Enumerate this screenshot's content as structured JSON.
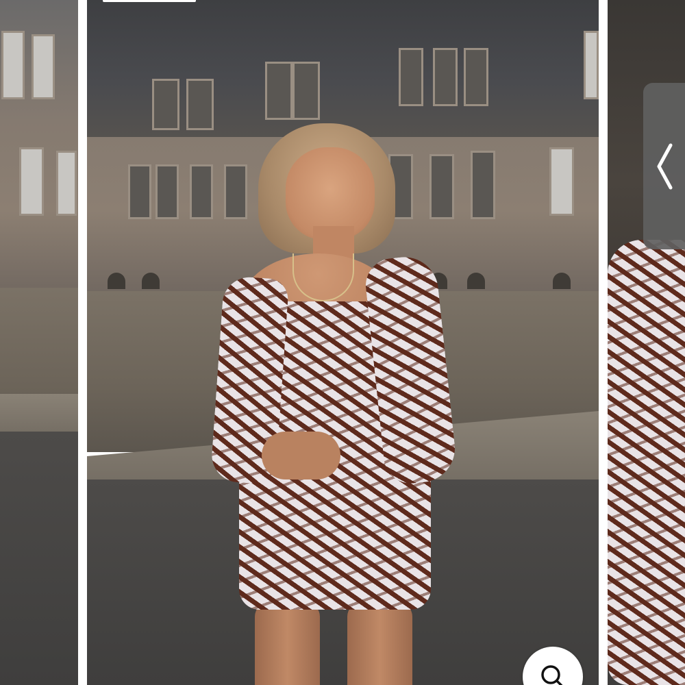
{
  "gallery": {
    "slides": [
      {
        "position": "previous",
        "description_icon": "photo"
      },
      {
        "position": "current",
        "description_icon": "photo"
      },
      {
        "position": "next",
        "description_icon": "photo"
      }
    ],
    "side_tab": {
      "icon": "chevron-left-icon"
    },
    "zoom_button": {
      "icon": "search-icon"
    },
    "indicator": {
      "icon": "progress-indicator"
    }
  },
  "colors": {
    "background": "#ffffff",
    "side_tab": "#5f5f5f",
    "dress_primary": "#5e2a1c",
    "dress_secondary": "#e9e3e6"
  }
}
